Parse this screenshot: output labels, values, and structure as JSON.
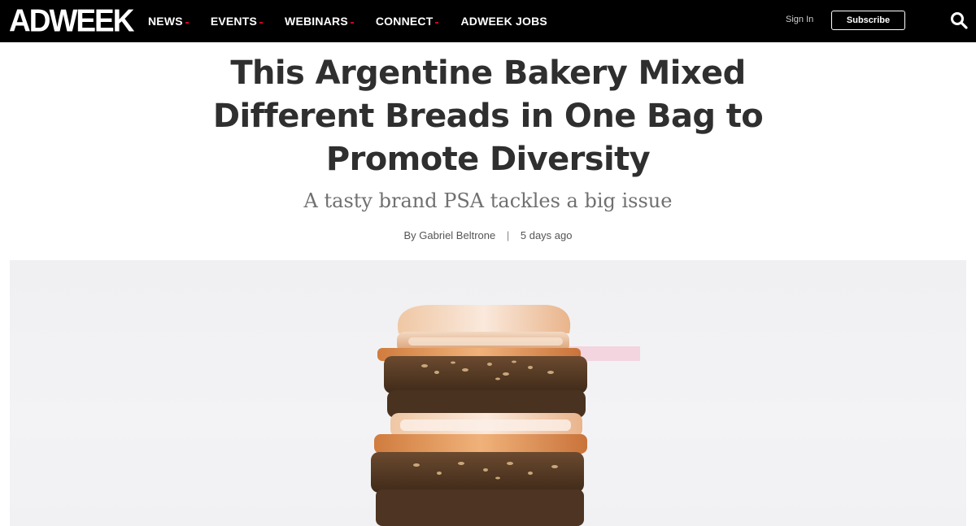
{
  "header": {
    "logo": "ADWEEK",
    "nav": [
      {
        "label": "NEWS",
        "has_dropdown": true
      },
      {
        "label": "EVENTS",
        "has_dropdown": true
      },
      {
        "label": "WEBINARS",
        "has_dropdown": true
      },
      {
        "label": "CONNECT",
        "has_dropdown": true
      },
      {
        "label": "ADWEEK JOBS",
        "has_dropdown": false
      }
    ],
    "sign_in": "Sign In",
    "subscribe": "Subscribe",
    "search_icon": "search-icon"
  },
  "article": {
    "headline": "This Argentine Bakery Mixed Different Breads in One Bag to Promote Diversity",
    "dek": "A tasty brand PSA tackles a big issue",
    "author": "By Gabriel Beltrone",
    "separator": "|",
    "time": "5 days ago",
    "hero_image": "stack-of-mixed-bread-slices"
  },
  "colors": {
    "topbar_bg": "#000000",
    "accent_dot": "#d0021b",
    "headline": "#2f2f2f",
    "dek": "#707070"
  }
}
